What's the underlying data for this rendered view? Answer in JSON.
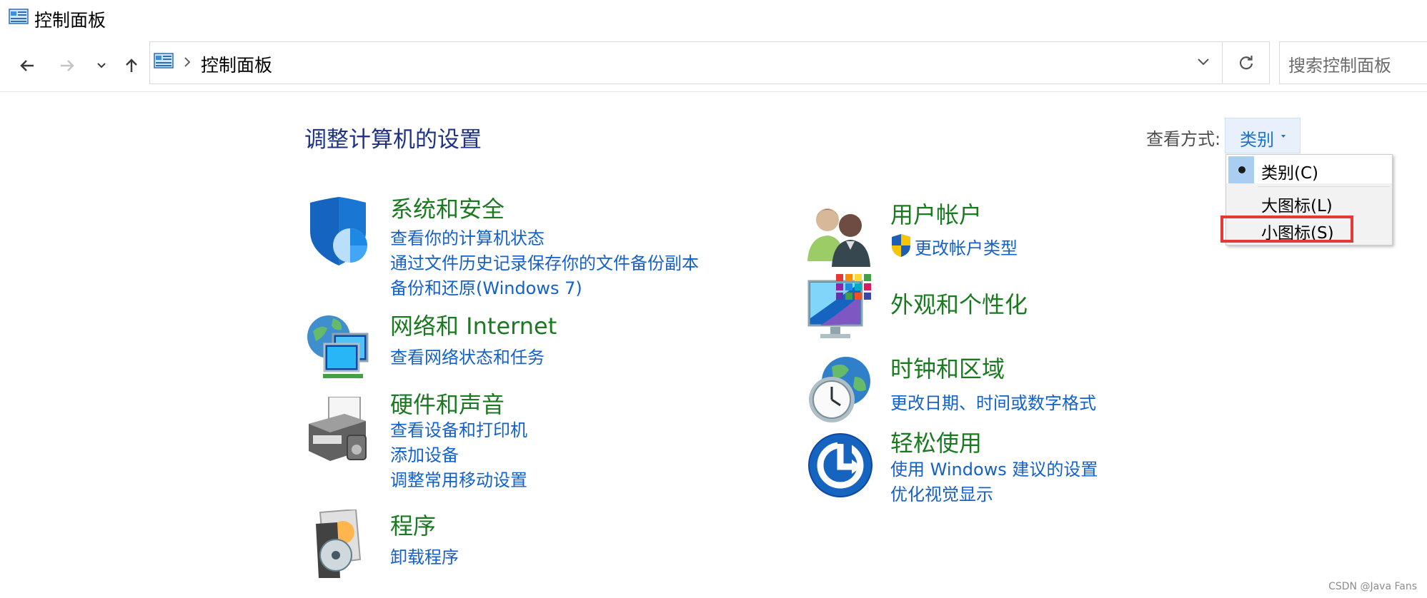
{
  "window": {
    "title": "控制面板"
  },
  "nav": {
    "breadcrumb": [
      "控制面板"
    ],
    "search_placeholder": "搜索控制面板"
  },
  "main": {
    "title": "调整计算机的设置",
    "view_by": {
      "label": "查看方式:",
      "value": "类别"
    },
    "categories": [
      {
        "heading": "系统和安全",
        "links": [
          "查看你的计算机状态",
          "通过文件历史记录保存你的文件备份副本",
          "备份和还原(Windows 7)"
        ]
      },
      {
        "heading": "网络和 Internet",
        "links": [
          "查看网络状态和任务"
        ]
      },
      {
        "heading": "硬件和声音",
        "links": [
          "查看设备和打印机",
          "添加设备",
          "调整常用移动设置"
        ]
      },
      {
        "heading": "程序",
        "links": [
          "卸载程序"
        ]
      },
      {
        "heading": "用户帐户",
        "links": [
          "更改帐户类型"
        ]
      },
      {
        "heading": "外观和个性化",
        "links": []
      },
      {
        "heading": "时钟和区域",
        "links": [
          "更改日期、时间或数字格式"
        ]
      },
      {
        "heading": "轻松使用",
        "links": [
          "使用 Windows 建议的设置",
          "优化视觉显示"
        ]
      }
    ]
  },
  "view_menu": {
    "items": [
      {
        "label": "类别(C)",
        "selected": true
      },
      {
        "label": "大图标(L)",
        "selected": false
      },
      {
        "label": "小图标(S)",
        "selected": false,
        "highlighted": true
      }
    ]
  },
  "watermark": "CSDN @Java Fans",
  "colors": {
    "heading_green": "#1b7a21",
    "link_blue": "#1461c9",
    "title_blue": "#1e3287",
    "highlight_red": "#e53935"
  }
}
